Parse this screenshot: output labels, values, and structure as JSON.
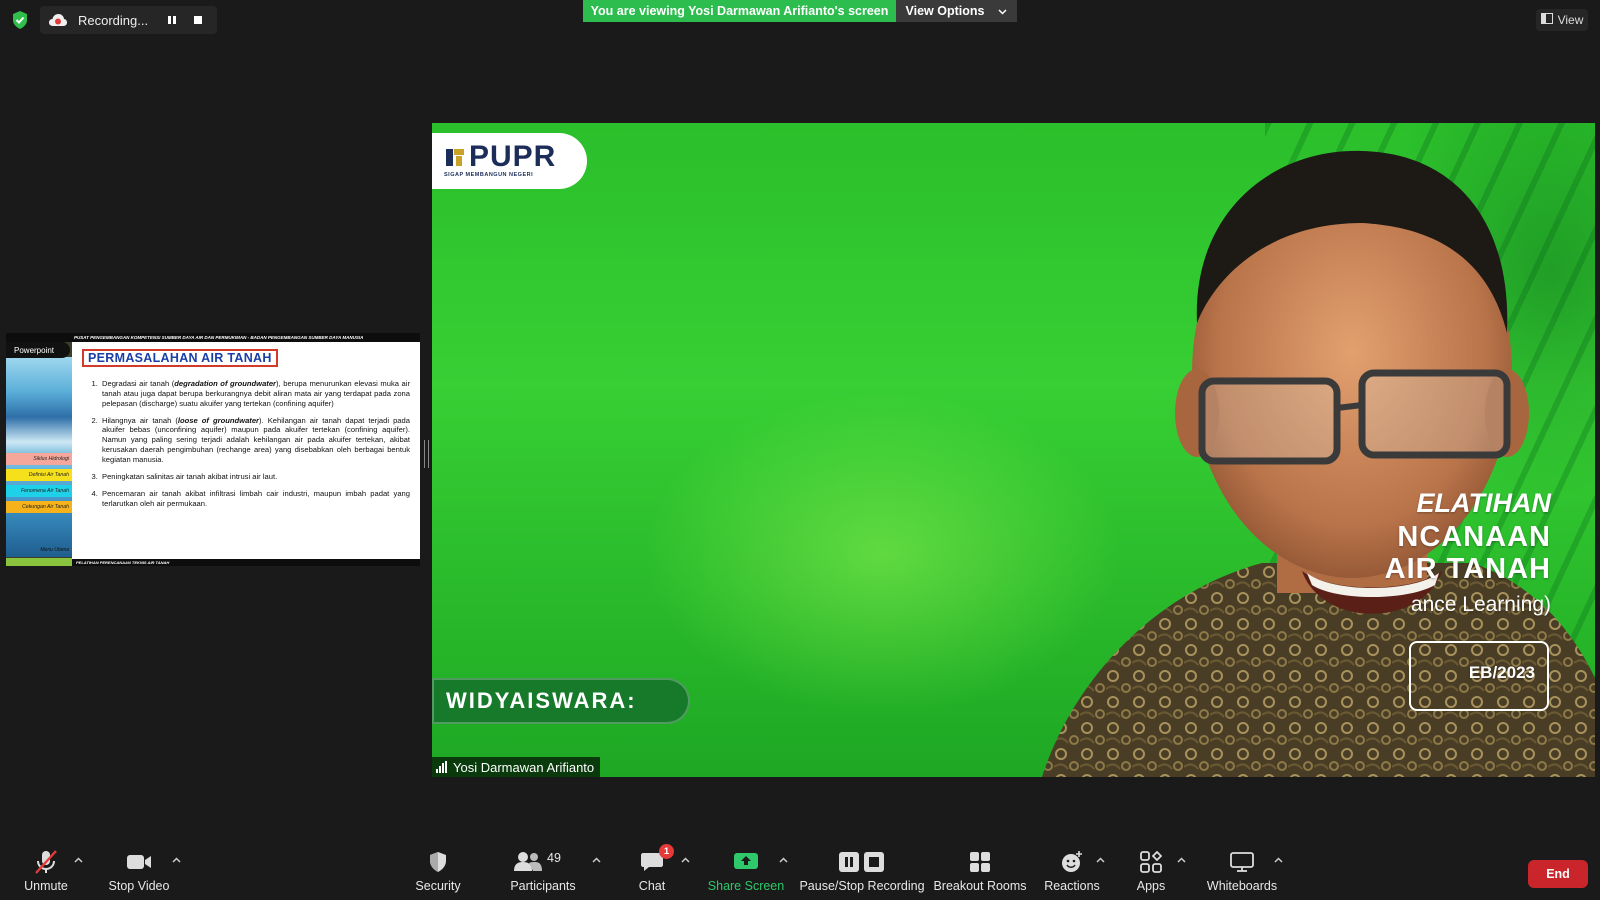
{
  "top_bar": {
    "recording_label": "Recording...",
    "viewing_banner": "You are viewing Yosi Darmawan Arifianto's screen",
    "view_options_label": "View Options",
    "view_label": "View"
  },
  "shared_slide": {
    "header_strip": "PUSAT PENGEMBANGAN KOMPETENSI SUMBER DAYA AIR DAN PERMUKIMAN - BADAN PENGEMBANGAN SUMBER DAYA MANUSIA",
    "powerpoint_tag": "Powerpoint",
    "title": "PERMASALAHAN AIR TANAH",
    "side_menu": [
      "Siklus Hidrologi",
      "Definisi Air Tanah",
      "Fenomena Air Tanah",
      "Cekungan Air Tanah",
      "Menu Utama"
    ],
    "footer_strip": "PELATIHAN PERENCANAAN TEKNIS AIR TANAH",
    "items": [
      {
        "before": "Degradasi air tanah (",
        "em": "degradation of groundwater",
        "after": "), berupa menurunkan elevasi muka air tanah atau juga dapat berupa berkurangnya debit aliran mata air yang terdapat pada zona pelepasan (discharge) suatu akuifer yang tertekan (confining aquifer)"
      },
      {
        "before": "Hilangnya air tanah (",
        "em": "loose of groundwater",
        "after": "). Kehilangan air tanah dapat terjadi pada akuifer bebas (unconfining aquifer) maupun pada akuifer tertekan (confining aquifer). Namun yang paling sering terjadi adalah kehilangan air pada akuifer tertekan, akibat kerusakan daerah pengimbuhan (rechange area) yang disebabkan oleh berbagai bentuk kegiatan manusia."
      },
      {
        "before": "Peningkatan salinitas air tanah akibat intrusi air laut.",
        "em": "",
        "after": ""
      },
      {
        "before": "Pencemaran air tanah akibat infiltrasi limbah cair industri, maupun imbah padat yang terlarutkan oleh air permukaan.",
        "em": "",
        "after": ""
      }
    ]
  },
  "video": {
    "logo_text": "PUPR",
    "logo_subtext": "SIGAP MEMBANGUN NEGERI",
    "widyaiswara_label": "WIDYAISWARA:",
    "overlay_lines": [
      "ELATIHAN",
      "NCANAAN",
      "AIR TANAH",
      "ance Learning)",
      "EB/2023"
    ],
    "participant_name": "Yosi Darmawan Arifianto"
  },
  "toolbar": {
    "unmute": "Unmute",
    "stop_video": "Stop Video",
    "security": "Security",
    "participants": "Participants",
    "participants_count": "49",
    "chat": "Chat",
    "chat_badge": "1",
    "share_screen": "Share Screen",
    "pause_stop_recording": "Pause/Stop Recording",
    "breakout_rooms": "Breakout Rooms",
    "reactions": "Reactions",
    "apps": "Apps",
    "whiteboards": "Whiteboards",
    "end": "End"
  },
  "colors": {
    "banner_green": "#2dbd4e",
    "share_green": "#2fc86a",
    "end_red": "#c9252b",
    "badge_red": "#e43a3a",
    "background": "#1a1a1a"
  }
}
